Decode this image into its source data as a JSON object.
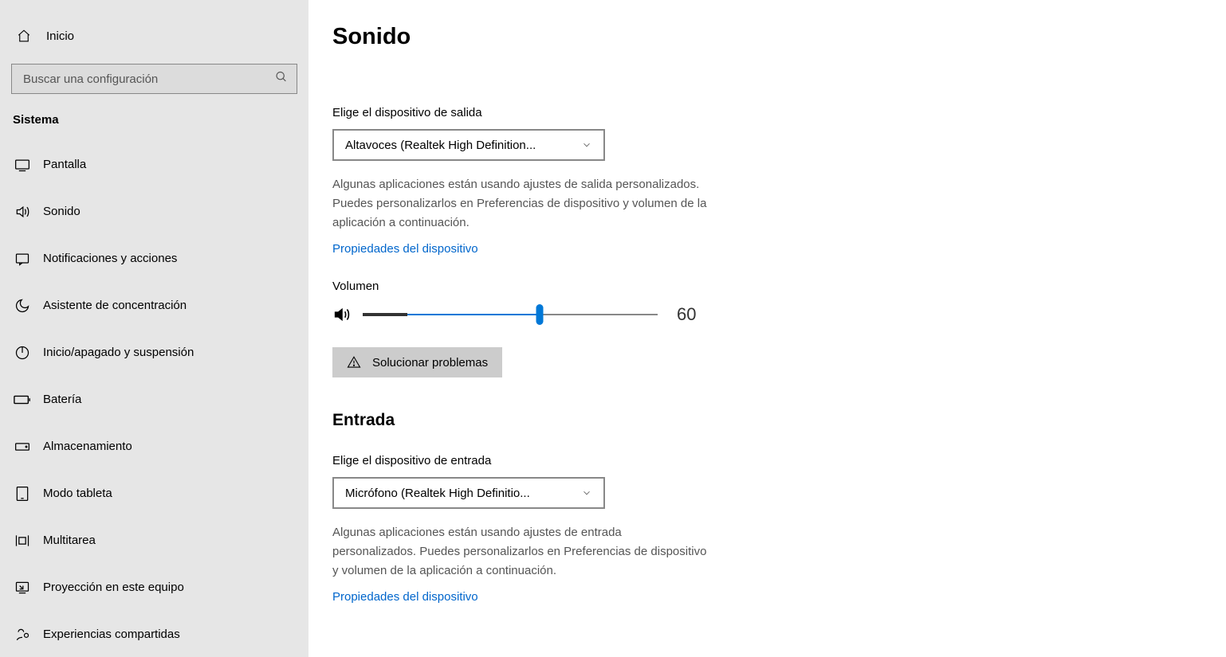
{
  "sidebar": {
    "home_label": "Inicio",
    "search_placeholder": "Buscar una configuración",
    "section_header": "Sistema",
    "items": [
      {
        "label": "Pantalla"
      },
      {
        "label": "Sonido"
      },
      {
        "label": "Notificaciones y acciones"
      },
      {
        "label": "Asistente de concentración"
      },
      {
        "label": "Inicio/apagado y suspensión"
      },
      {
        "label": "Batería"
      },
      {
        "label": "Almacenamiento"
      },
      {
        "label": "Modo tableta"
      },
      {
        "label": "Multitarea"
      },
      {
        "label": "Proyección en este equipo"
      },
      {
        "label": "Experiencias compartidas"
      }
    ]
  },
  "main": {
    "title": "Sonido",
    "output": {
      "device_label": "Elige el dispositivo de salida",
      "device_selected": "Altavoces (Realtek High Definition...",
      "help_text": "Algunas aplicaciones están usando ajustes de salida personalizados. Puedes personalizarlos en Preferencias de dispositivo y volumen de la aplicación a continuación.",
      "props_link": "Propiedades del dispositivo",
      "volume_label": "Volumen",
      "volume_value": "60",
      "troubleshoot_label": "Solucionar problemas"
    },
    "input": {
      "section_title": "Entrada",
      "device_label": "Elige el dispositivo de entrada",
      "device_selected": "Micrófono (Realtek High Definitio...",
      "help_text": "Algunas aplicaciones están usando ajustes de entrada personalizados. Puedes personalizarlos en Preferencias de dispositivo y volumen de la aplicación a continuación.",
      "props_link": "Propiedades del dispositivo"
    }
  }
}
